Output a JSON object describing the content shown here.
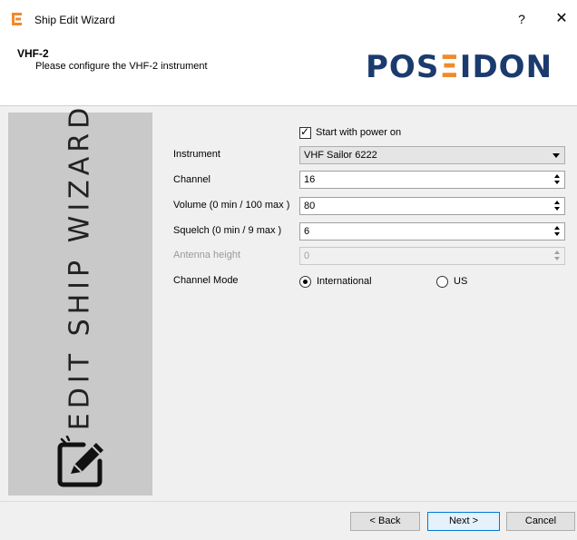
{
  "window": {
    "title": "Ship Edit Wizard",
    "help_label": "?",
    "close_label": "✕"
  },
  "header": {
    "title": "VHF-2",
    "subtitle": "Please configure the VHF-2 instrument",
    "logo_prefix": "POS",
    "logo_mark": "Ξ",
    "logo_suffix": "IDON"
  },
  "side_banner": {
    "text": "EDIT SHIP WIZARD",
    "icon": "edit-pencil-icon"
  },
  "form": {
    "start_power": {
      "label": "Start with power on",
      "checked": true,
      "mark": "✓"
    },
    "instrument": {
      "label": "Instrument",
      "value": "VHF Sailor 6222"
    },
    "channel": {
      "label": "Channel",
      "value": "16"
    },
    "volume": {
      "label": "Volume (0 min / 100 max )",
      "value": "80"
    },
    "squelch": {
      "label": "Squelch (0 min / 9 max )",
      "value": "6"
    },
    "antenna": {
      "label": "Antenna height",
      "value": "0",
      "disabled": true
    },
    "channel_mode": {
      "label": "Channel Mode",
      "options": [
        {
          "label": "International",
          "selected": true
        },
        {
          "label": "US",
          "selected": false
        }
      ]
    }
  },
  "footer": {
    "back_label": "< Back",
    "next_label": "Next >",
    "cancel_label": "Cancel"
  },
  "colors": {
    "logo_blue": "#1b3b6e",
    "logo_orange": "#f08a2c",
    "banner_gray": "#c9c9c9",
    "primary_border": "#0078d7"
  }
}
